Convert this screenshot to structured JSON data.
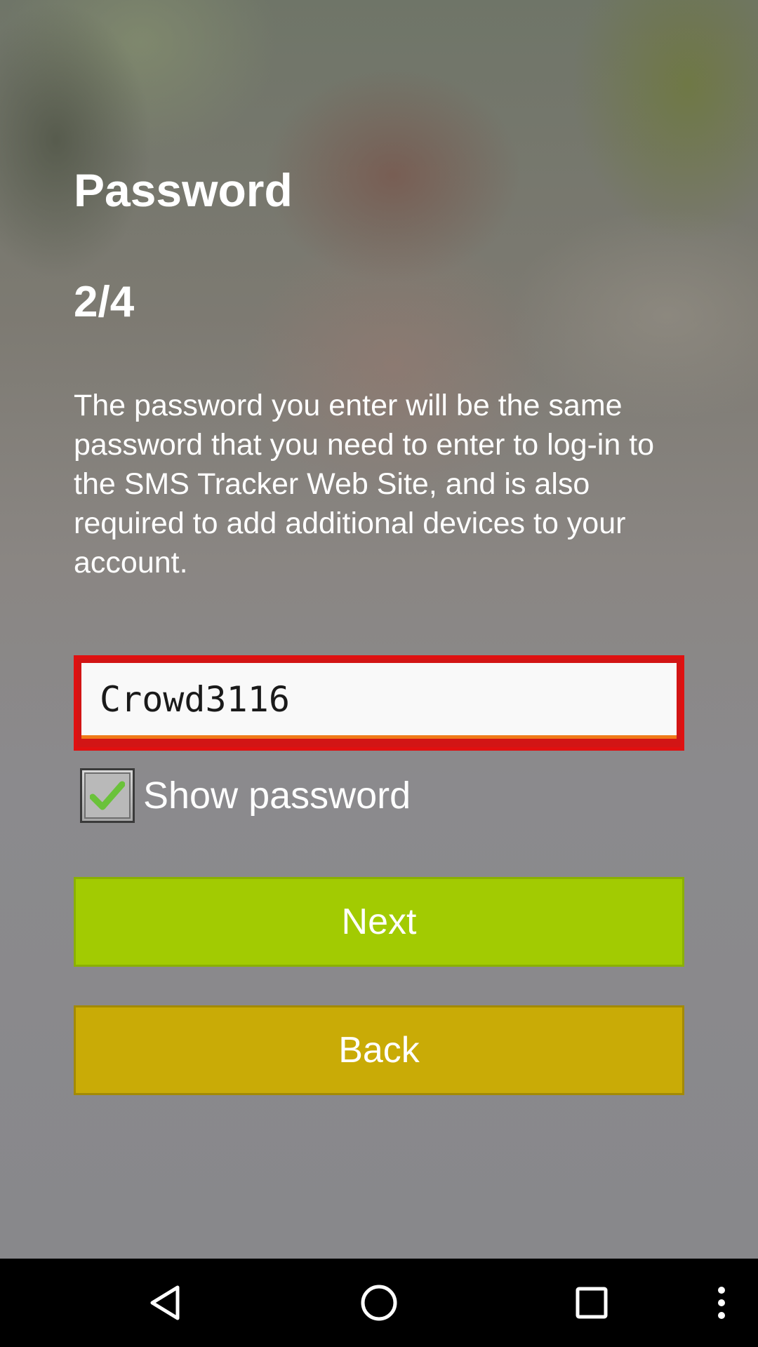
{
  "screen": {
    "title": "Password",
    "step": "2/4",
    "description": "The password you enter will be the same password that you need to enter to log-in to the SMS Tracker Web Site, and is also required to add additional devices to your account."
  },
  "password_field": {
    "value": "Crowd3116"
  },
  "show_password": {
    "label": "Show password",
    "checked": true
  },
  "buttons": {
    "next_label": "Next",
    "back_label": "Back"
  },
  "colors": {
    "next_bg": "#a2cb02",
    "back_bg": "#c9ab06",
    "field_border": "#e01010",
    "field_underline": "#f07a18",
    "check_green": "#6ac23a"
  },
  "navbar": {
    "icons": [
      "back-triangle-icon",
      "home-circle-icon",
      "recents-square-icon",
      "overflow-menu-icon"
    ]
  }
}
